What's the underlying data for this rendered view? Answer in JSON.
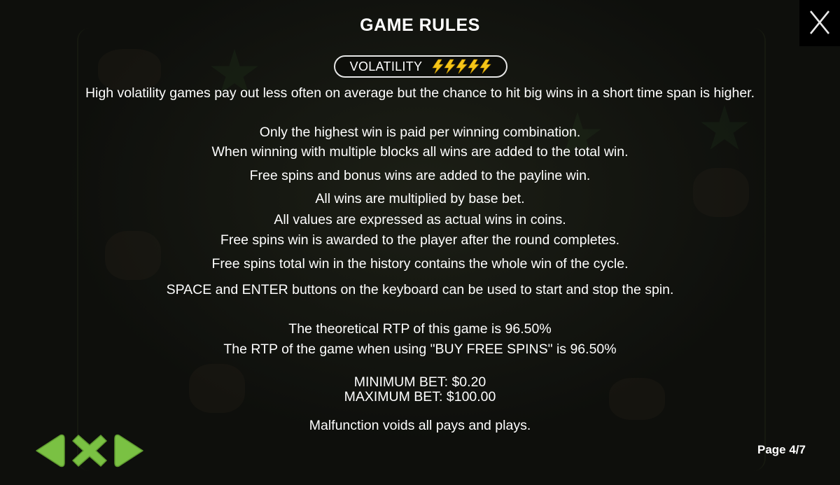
{
  "header": {
    "title": "GAME RULES"
  },
  "volatility": {
    "label": "VOLATILITY",
    "level": 5,
    "max": 5,
    "bolt_color": "#f5c518"
  },
  "rules": {
    "volatility_note": "High volatility games pay out less often on average but the chance to hit big wins in a short time span is higher.",
    "lines": [
      "Only the highest win is paid per winning combination.",
      "When winning with multiple blocks all wins are added to the total win.",
      "Free spins and bonus wins are added to the payline win.",
      "All wins are multiplied by base bet.",
      "All values are expressed as actual wins in coins.",
      "Free spins win is awarded to the player after the round completes.",
      "Free spins total win in the history contains the whole win of the cycle.",
      "SPACE and ENTER buttons on the keyboard can be used to start and stop the spin."
    ],
    "rtp": [
      "The theoretical RTP of this game is 96.50%",
      "The RTP of the game when using \"BUY FREE SPINS\" is 96.50%"
    ],
    "bets": [
      "MINIMUM BET: $0.20",
      "MAXIMUM BET: $100.00"
    ],
    "malfunction": "Malfunction voids all pays and plays."
  },
  "navigation": {
    "icons": [
      "arrow-left-icon",
      "close-x-icon",
      "arrow-right-icon"
    ],
    "color": "#7ac143"
  },
  "page_indicator": "Page 4/7"
}
